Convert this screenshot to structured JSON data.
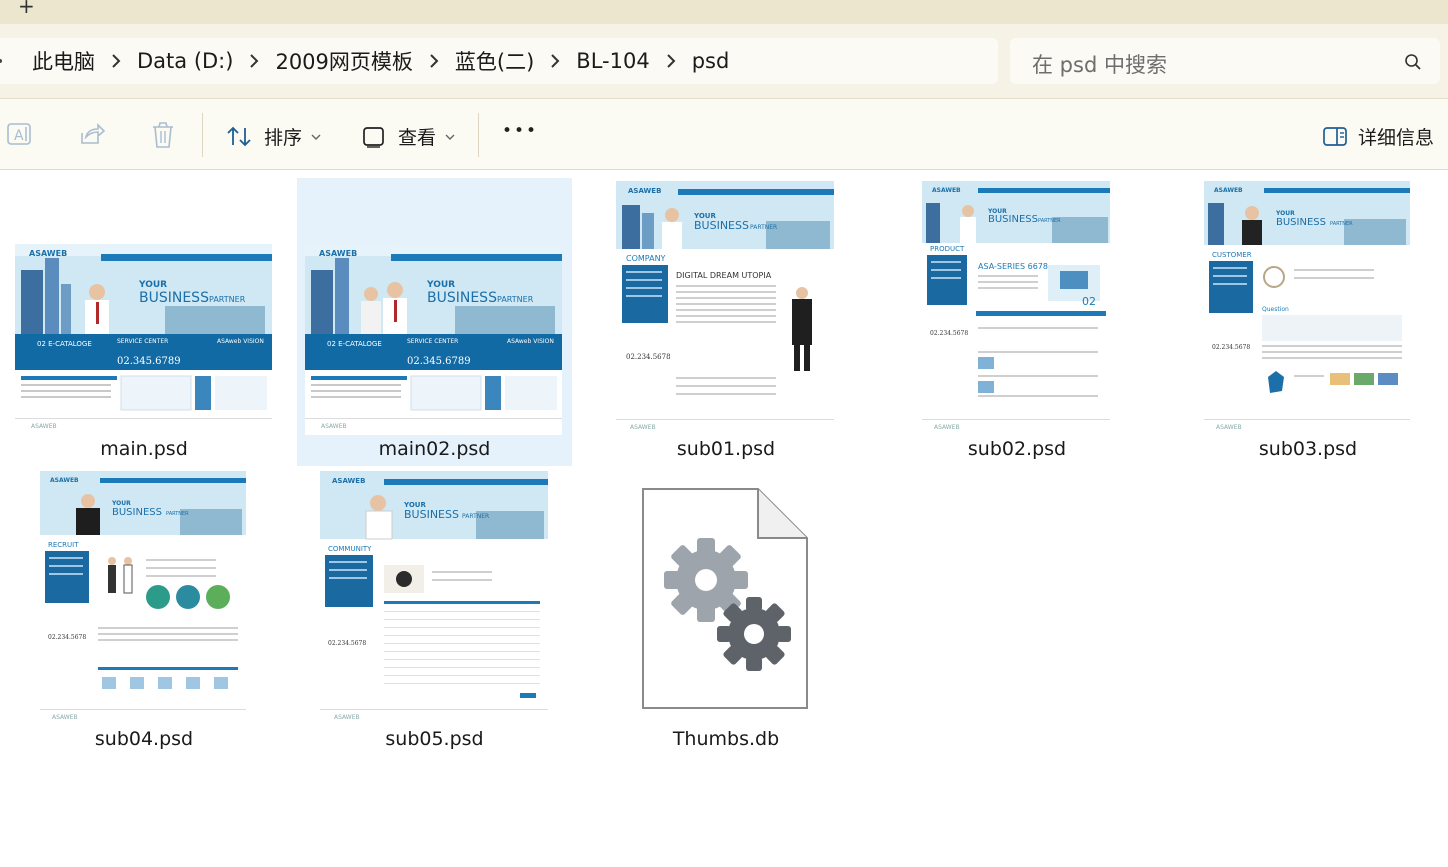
{
  "window": {
    "new_tab_glyph": "+"
  },
  "breadcrumb": {
    "items": [
      "此电脑",
      "Data (D:)",
      "2009网页模板",
      "蓝色(二)",
      "BL-104",
      "psd"
    ],
    "separator_icon": "chevron-right-icon"
  },
  "search": {
    "placeholder": "在 psd 中搜索",
    "icon": "search-icon"
  },
  "toolbar": {
    "rename_icon": "rename-icon",
    "share_icon": "share-icon",
    "delete_icon": "delete-icon",
    "sort_label": "排序",
    "view_label": "查看",
    "more_label": "•••",
    "details_label": "详细信息"
  },
  "files": [
    {
      "name": "main.psd",
      "kind": "psd-thumbnail",
      "variant": "main"
    },
    {
      "name": "main02.psd",
      "kind": "psd-thumbnail",
      "variant": "main",
      "selected": true
    },
    {
      "name": "sub01.psd",
      "kind": "psd-thumbnail",
      "variant": "sub",
      "section": "COMPANY"
    },
    {
      "name": "sub02.psd",
      "kind": "psd-thumbnail",
      "variant": "sub",
      "section": "PRODUCT"
    },
    {
      "name": "sub03.psd",
      "kind": "psd-thumbnail",
      "variant": "sub",
      "section": "CUSTOMER"
    },
    {
      "name": "sub04.psd",
      "kind": "psd-thumbnail",
      "variant": "sub",
      "section": "RECRUIT"
    },
    {
      "name": "sub05.psd",
      "kind": "psd-thumbnail",
      "variant": "sub",
      "section": "COMMUNITY"
    },
    {
      "name": "Thumbs.db",
      "kind": "system-file",
      "icon": "gears-file-icon"
    }
  ],
  "thumb_text": {
    "brand": "ASAWEB",
    "headline_small": "YOUR",
    "headline_big": "BUSINESS",
    "headline_tail": "PARTNER",
    "catalog": "02 E-CATALOGE",
    "service_center": "SERVICE CENTER",
    "main_phone": "02.345.6789",
    "vision": "ASAweb VISION",
    "sub_phone": "02.234.5678",
    "company_title": "DIGITAL DREAM UTOPIA",
    "product_title": "ASA-SERIES 6678",
    "product_num": "02",
    "customer_title": "Question"
  },
  "colors": {
    "accent": "#1c7ab8",
    "selected_bg": "#e5f1fb",
    "toolbar_bg": "#fbfaf3",
    "addr_bg": "#f6f3e6",
    "title_bg": "#ece6cf"
  }
}
